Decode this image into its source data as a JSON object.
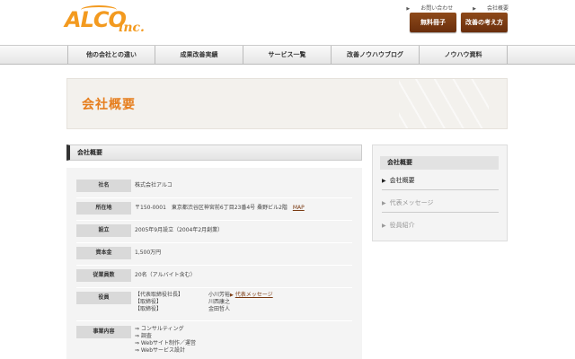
{
  "header": {
    "logo_main": "ALCO",
    "logo_sub": "inc.",
    "top_links": [
      "お問い合わせ",
      "会社概要"
    ],
    "buttons": [
      "無料冊子",
      "改善の考え方"
    ]
  },
  "nav": {
    "items": [
      "他の会社との違い",
      "成果改善実績",
      "サービス一覧",
      "改善ノウハウブログ",
      "ノウハウ資料"
    ]
  },
  "banner": {
    "title": "会社概要"
  },
  "section": {
    "title": "会社概要"
  },
  "company": {
    "rows": [
      {
        "label": "社名",
        "value": "株式会社アルコ"
      },
      {
        "label": "所在地",
        "value": "〒150-0001　東京都渋谷区神宮前6丁目23番4号 桑野ビル2階",
        "link": "MAP"
      },
      {
        "label": "設立",
        "value": "2005年9月設立（2004年2月創業）"
      },
      {
        "label": "資本金",
        "value": "1,500万円"
      },
      {
        "label": "従業員数",
        "value": "20名（アルバイト含む）"
      }
    ],
    "officers": {
      "label": "役員",
      "titles": [
        "【代表取締役社長】",
        "【取締役】",
        "【取締役】"
      ],
      "names": [
        "小川芳裕",
        "川西康之",
        "金田哲人"
      ],
      "link": "代表メッセージ"
    },
    "business": {
      "label": "事業内容",
      "items": [
        "⇒ コンサルティング",
        "⇒ 調査",
        "⇒ Webサイト制作／運営",
        "⇒ Webサービス設計"
      ]
    }
  },
  "sidebar": {
    "head": "会社概要",
    "items": [
      "会社概要",
      "代表メッセージ",
      "役員紹介"
    ]
  }
}
